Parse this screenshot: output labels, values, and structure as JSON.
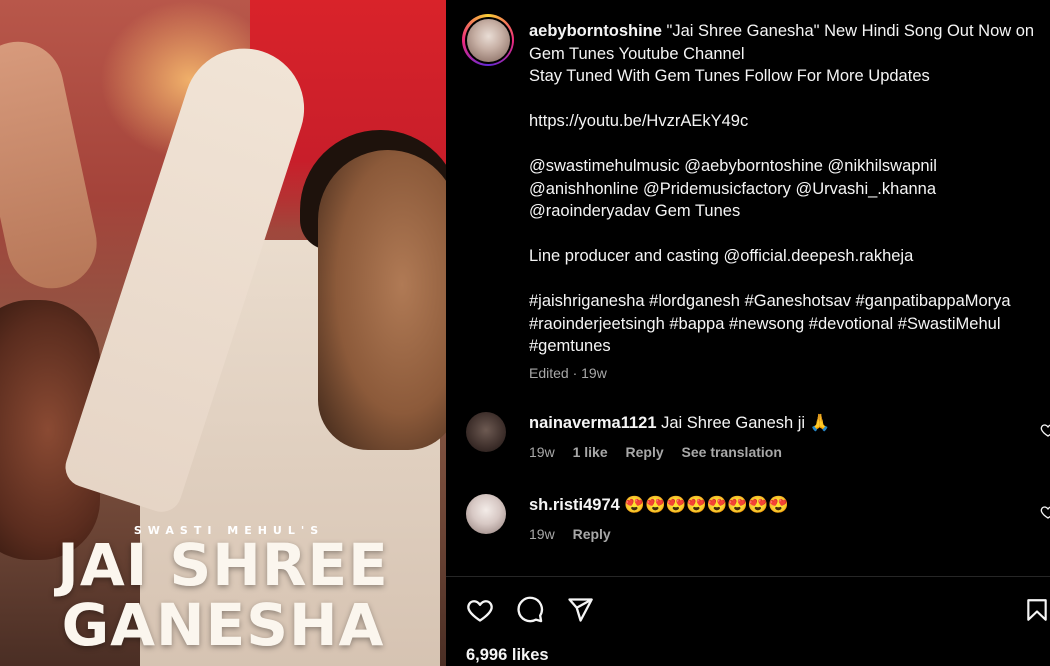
{
  "post": {
    "artist_credit": "SWASTI MEHUL'S",
    "title_line1": "JAI SHREE",
    "title_line2": "GANESHA"
  },
  "caption": {
    "username": "aebyborntoshine",
    "line1": " \"Jai Shree Ganesha\" New Hindi Song Out Now on Gem Tunes Youtube Channel",
    "line2": "Stay Tuned With Gem Tunes Follow For More Updates",
    "link": "https://youtu.be/HvzrAEkY49c",
    "mentions": "@swastimehulmusic @aebyborntoshine @nikhilswapnil @anishhonline @Pridemusicfactory @Urvashi_.khanna @raoinderyadav Gem Tunes",
    "credits": "Line producer and casting @official.deepesh.rakheja",
    "hashtags": "#jaishriganesha #lordganesh #Ganeshotsav #ganpatibappaMorya #raoinderjeetsingh #bappa #newsong #devotional #SwastiMehul #gemtunes",
    "edited": "Edited · 19w"
  },
  "comments": [
    {
      "username": "nainaverma1121",
      "text": " Jai Shree Ganesh ji 🙏",
      "time": "19w",
      "likes": "1 like",
      "reply": "Reply",
      "translate": "See translation"
    },
    {
      "username": "sh.risti4974",
      "text": " 😍😍😍😍😍😍😍😍",
      "time": "19w",
      "reply": "Reply"
    }
  ],
  "likes_count": "6,996 likes",
  "icons": {
    "like": "heart-icon",
    "comment": "comment-icon",
    "share": "send-icon",
    "save": "bookmark-icon"
  },
  "colors": {
    "background": "#000000",
    "text": "#f5f5f5",
    "muted": "#a8a8a8",
    "divider": "#262626"
  }
}
